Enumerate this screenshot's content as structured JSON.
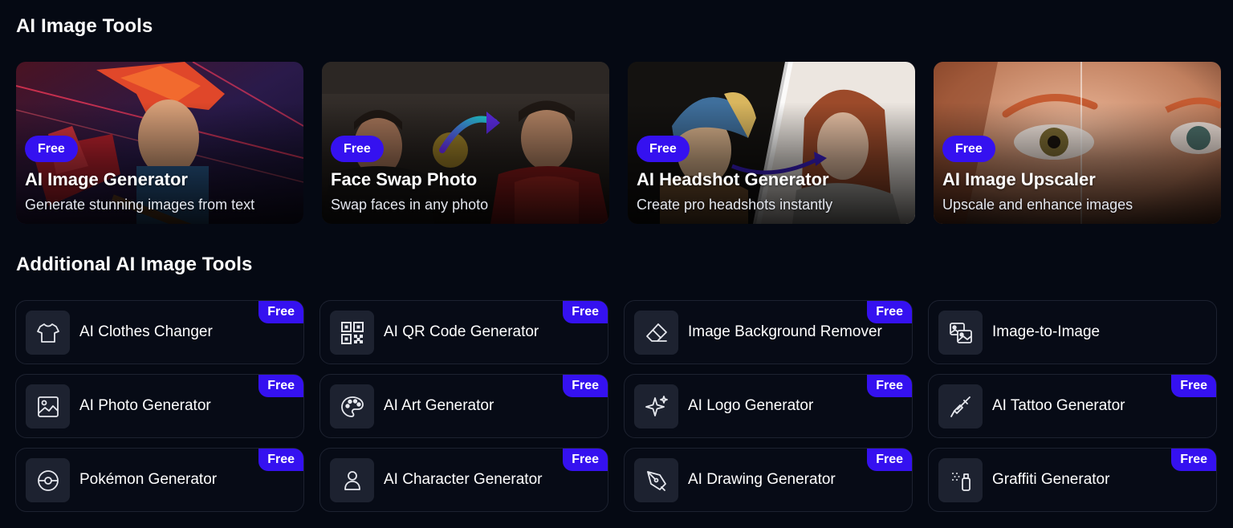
{
  "sections": {
    "featured_title": "AI Image Tools",
    "additional_title": "Additional AI Image Tools"
  },
  "featured": [
    {
      "badge": "Free",
      "title": "AI Image Generator",
      "subtitle": "Generate stunning images from text"
    },
    {
      "badge": "Free",
      "title": "Face Swap Photo",
      "subtitle": "Swap faces in any photo"
    },
    {
      "badge": "Free",
      "title": "AI Headshot Generator",
      "subtitle": "Create pro headshots instantly"
    },
    {
      "badge": "Free",
      "title": "AI Image Upscaler",
      "subtitle": "Upscale and enhance images"
    }
  ],
  "tools": [
    {
      "label": "AI Clothes Changer",
      "badge": "Free",
      "icon": "shirt-icon"
    },
    {
      "label": "AI QR Code Generator",
      "badge": "Free",
      "icon": "qr-code-icon"
    },
    {
      "label": "Image Background Remover",
      "badge": "Free",
      "icon": "eraser-icon"
    },
    {
      "label": "Image-to-Image",
      "icon": "images-icon"
    },
    {
      "label": "AI Photo Generator",
      "badge": "Free",
      "icon": "photo-icon"
    },
    {
      "label": "AI Art Generator",
      "badge": "Free",
      "icon": "palette-icon"
    },
    {
      "label": "AI Logo Generator",
      "badge": "Free",
      "icon": "sparkle-icon"
    },
    {
      "label": "AI Tattoo Generator",
      "badge": "Free",
      "icon": "tattoo-pen-icon"
    },
    {
      "label": "Pokémon Generator",
      "badge": "Free",
      "icon": "pokeball-icon"
    },
    {
      "label": "AI Character Generator",
      "badge": "Free",
      "icon": "person-icon"
    },
    {
      "label": "AI Drawing Generator",
      "badge": "Free",
      "icon": "pen-nib-icon"
    },
    {
      "label": "Graffiti Generator",
      "badge": "Free",
      "icon": "spray-can-icon"
    }
  ],
  "colors": {
    "background": "#050913",
    "badge": "#3511f0",
    "card_border": "#1d2230",
    "icon_box": "#1d2230"
  }
}
